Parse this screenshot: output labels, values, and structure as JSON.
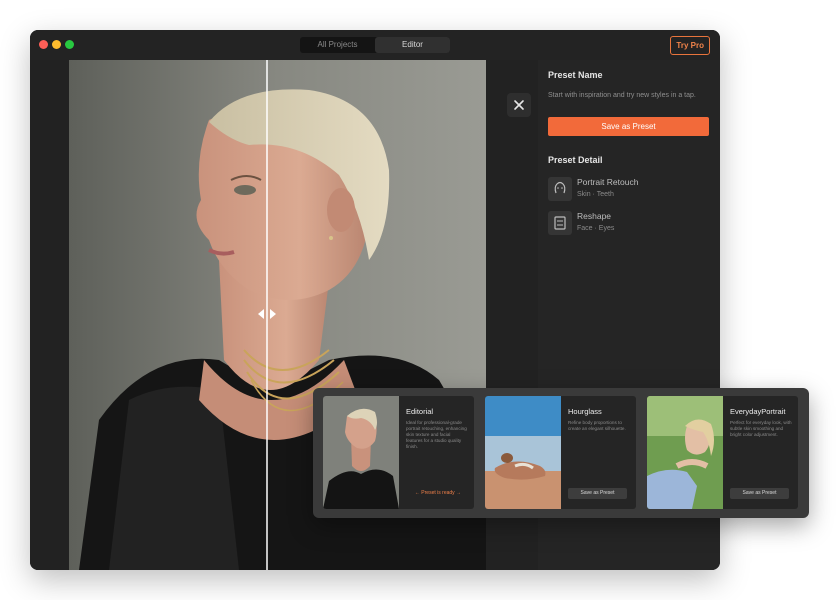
{
  "titlebar": {
    "tabs": [
      {
        "label": "All Projects",
        "active": false
      },
      {
        "label": "Editor",
        "active": true
      }
    ],
    "try_pro_label": "Try Pro"
  },
  "panel": {
    "preset_name_title": "Preset Name",
    "preset_name_sub": "Start with inspiration and try new styles in a tap.",
    "save_label": "Save as Preset",
    "preset_detail_title": "Preset Detail",
    "details": [
      {
        "name": "Portrait Retouch",
        "sub": "Skin · Teeth",
        "icon": "face-retouch-icon"
      },
      {
        "name": "Reshape",
        "sub": "Face · Eyes",
        "icon": "reshape-icon"
      }
    ]
  },
  "presets": [
    {
      "title": "Editorial",
      "desc": "Ideal for professional-grade portrait retouching, enhancing skin texture and facial features for a studio quality finish.",
      "status": "← Preset is ready →"
    },
    {
      "title": "Hourglass",
      "desc": "Refine body proportions to create an elegant silhouette.",
      "button": "Save as Preset"
    },
    {
      "title": "EverydayPortrait",
      "desc": "Perfect for everyday look, with subtle skin smoothing and bright color adjustment.",
      "button": "Save as Preset"
    }
  ],
  "colors": {
    "accent": "#f26a3a",
    "window_bg": "#1f1f1f",
    "panel_bg": "#252525"
  }
}
